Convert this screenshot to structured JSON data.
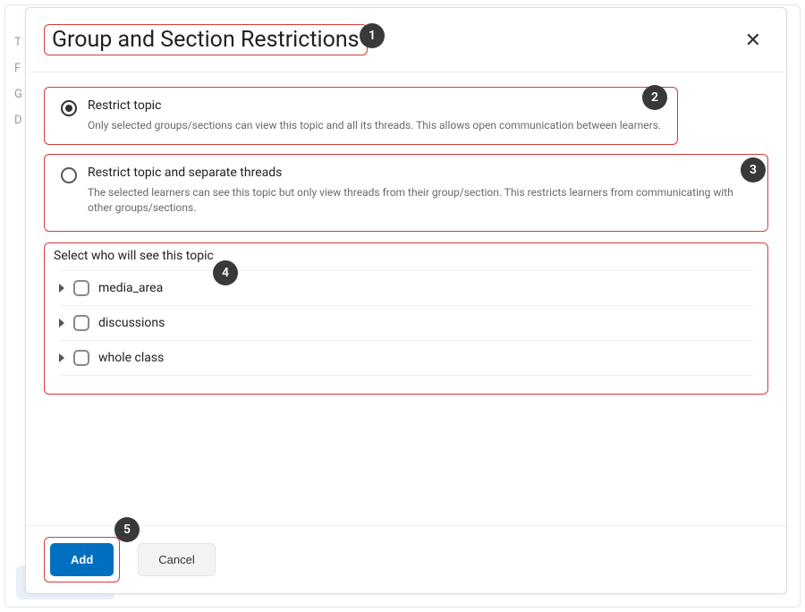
{
  "modal": {
    "title": "Group and Section Restrictions",
    "option1": {
      "label": "Restrict topic",
      "description": "Only selected groups/sections can view this topic and all its threads. This allows open communication between learners.",
      "selected": true
    },
    "option2": {
      "label": "Restrict topic and separate threads",
      "description": "The selected learners can see this topic but only view threads from their group/section. This restricts learners from communicating with other groups/sections.",
      "selected": false
    },
    "select_section": {
      "title": "Select who will see this topic",
      "items": [
        {
          "label": "media_area"
        },
        {
          "label": "discussions"
        },
        {
          "label": "whole class"
        }
      ]
    },
    "buttons": {
      "add": "Add",
      "cancel": "Cancel"
    }
  },
  "callouts": [
    "1",
    "2",
    "3",
    "4",
    "5"
  ],
  "background": {
    "labels": [
      "T",
      "F",
      "G",
      "D"
    ]
  }
}
